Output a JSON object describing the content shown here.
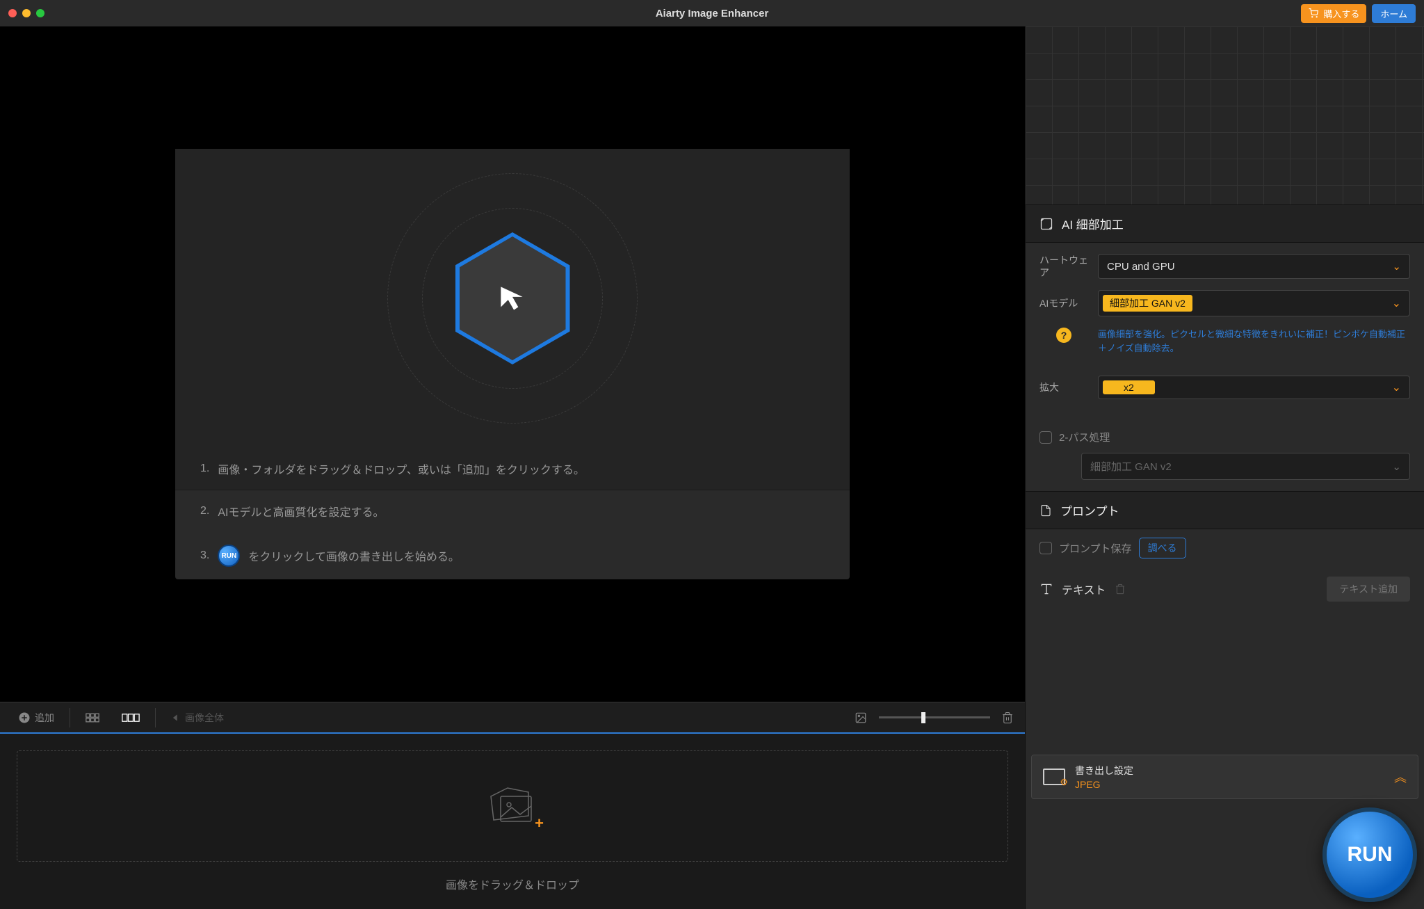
{
  "title": "Aiarty Image Enhancer",
  "header": {
    "buy_label": "購入する",
    "home_label": "ホーム"
  },
  "intro": {
    "step1_num": "1.",
    "step1": "画像・フォルダをドラッグ＆ドロップ、或いは「追加」をクリックする。",
    "step2_num": "2.",
    "step2": "AIモデルと高画質化を設定する。",
    "step3_num": "3.",
    "step3_run": "RUN",
    "step3": "をクリックして画像の書き出しを始める。"
  },
  "toolbar": {
    "add_label": "追加",
    "back_label": "画像全体"
  },
  "drop": {
    "label": "画像をドラッグ＆ドロップ"
  },
  "ai_section": {
    "title": "AI 細部加工",
    "hardware_label": "ハートウェア",
    "hardware_value": "CPU and GPU",
    "model_label": "AIモデル",
    "model_value": "細部加工 GAN v2",
    "model_help": "画像細部を強化。ピクセルと微細な特徴をきれいに補正！ピンボケ自動補正＋ノイズ自動除去。",
    "scale_label": "拡大",
    "scale_value": "x2",
    "pass2_label": "2-パス処理",
    "pass2_value": "細部加工 GAN v2"
  },
  "prompt_section": {
    "title": "プロンプト",
    "save_label": "プロンプト保存",
    "inspect_label": "調べる",
    "text_label": "テキスト",
    "add_text_label": "テキスト追加"
  },
  "export": {
    "title": "書き出し設定",
    "format": "JPEG"
  },
  "run": {
    "label": "RUN"
  }
}
